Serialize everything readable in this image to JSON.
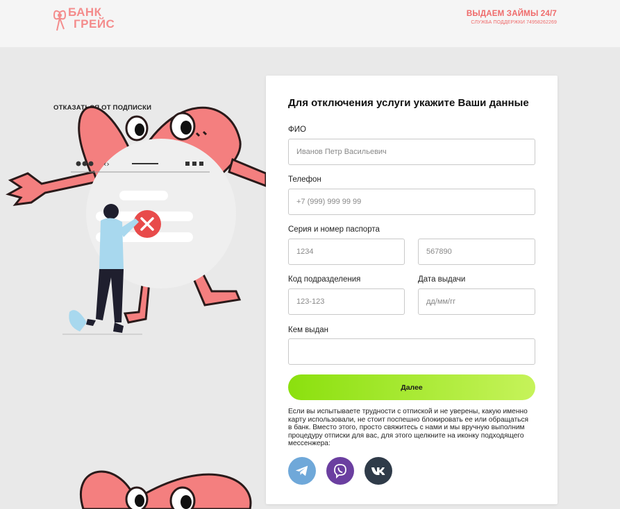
{
  "header": {
    "logo_line1": "БАНК",
    "logo_line2": "ГРЕЙС",
    "title": "ВЫДАЕМ ЗАЙМЫ 24/7",
    "support": "СЛУЖБА ПОДДЕРЖКИ 74958262269"
  },
  "left": {
    "unsubscribe_label": "ОТКАЗАТЬСЯ ОТ ПОДПИСКИ"
  },
  "form": {
    "title": "Для отключения услуги укажите Ваши данные",
    "fio_label": "ФИО",
    "fio_placeholder": "Иванов Петр Васильевич",
    "phone_label": "Телефон",
    "phone_placeholder": "+7 (999) 999 99 99",
    "passport_label": "Серия и номер паспорта",
    "series_placeholder": "1234",
    "number_placeholder": "567890",
    "division_label": "Код подразделения",
    "division_placeholder": "123-123",
    "issue_date_label": "Дата выдачи",
    "issue_date_placeholder": "дд/мм/гг",
    "issued_by_label": "Кем выдан",
    "issued_by_placeholder": "",
    "submit_label": "Далее",
    "help_text": "Если вы испытываете трудности с отпиской и не уверены, какую именно карту использовали, не стоит поспешно блокировать ее или обращаться в банк. Вместо этого, просто свяжитесь с нами и мы вручную выполним процедуру отписки для вас, для этого щелкните на иконку подходящего мессенжера:"
  },
  "messengers": [
    {
      "icon": "telegram-icon",
      "color": "#6fa8d9"
    },
    {
      "icon": "viber-icon",
      "color": "#6b3fa0"
    },
    {
      "icon": "vk-icon",
      "color": "#2f3b49"
    }
  ],
  "colors": {
    "accent": "#ef6a6a",
    "button_start": "#8be00e",
    "button_end": "#c6f35a",
    "heart": "#f47f7f"
  }
}
